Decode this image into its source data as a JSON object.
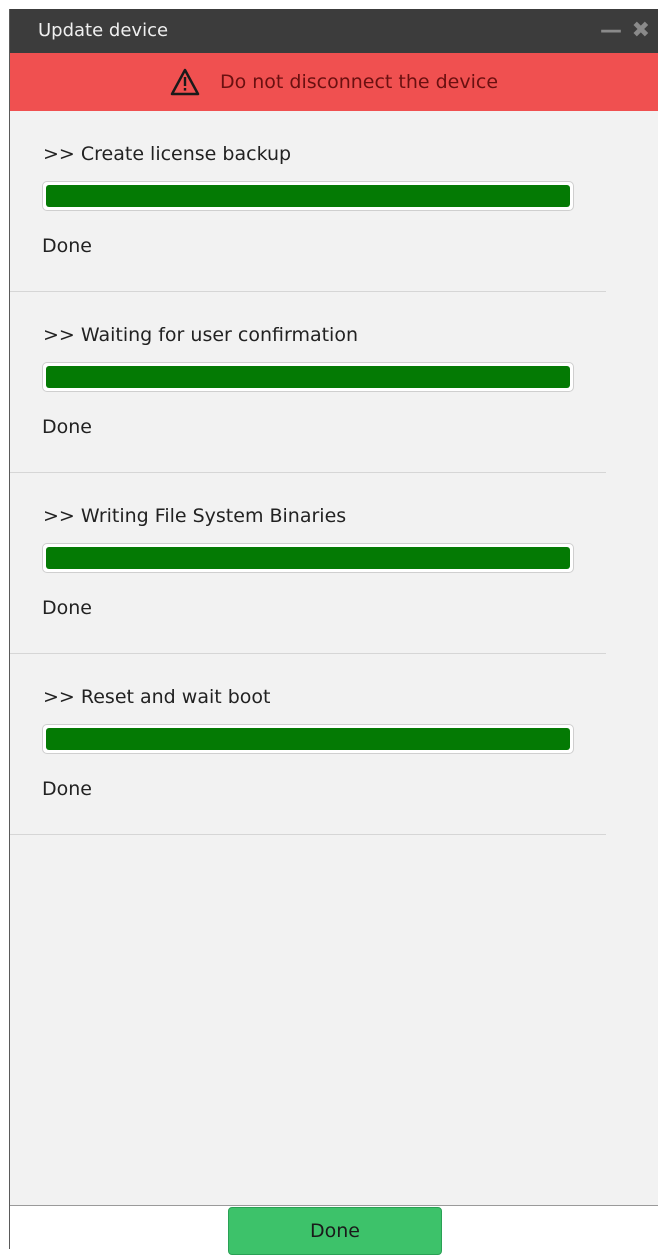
{
  "window": {
    "title": "Update device",
    "minimize_symbol": "—",
    "close_symbol": "✖"
  },
  "warning": {
    "icon": "warning-triangle-icon",
    "text": "Do not disconnect the device",
    "color": "#f05050"
  },
  "steps": [
    {
      "label": ">> Create license backup",
      "progress": 1.0,
      "status": "Done"
    },
    {
      "label": ">> Waiting for user confirmation",
      "progress": 1.0,
      "status": "Done"
    },
    {
      "label": ">> Writing File System Binaries",
      "progress": 1.0,
      "status": "Done"
    },
    {
      "label": ">> Reset and wait boot",
      "progress": 1.0,
      "status": "Done"
    }
  ],
  "footer": {
    "done_label": "Done",
    "button_color": "#3dc26a"
  },
  "colors": {
    "titlebar": "#3c3c3c",
    "progress_fill": "#047a04"
  }
}
